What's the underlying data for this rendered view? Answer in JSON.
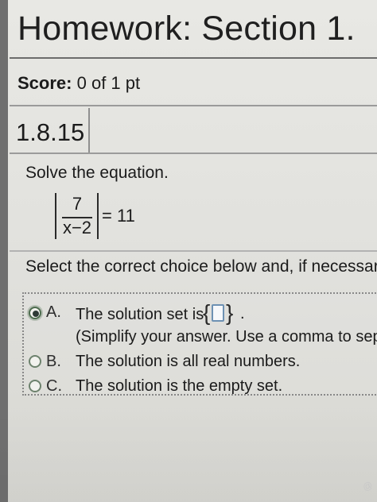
{
  "header": {
    "title": "Homework: Section 1."
  },
  "score": {
    "label": "Score:",
    "value": "0 of 1 pt"
  },
  "question": {
    "number": "1.8.15",
    "prompt": "Solve the equation.",
    "equation": {
      "numerator": "7",
      "denominator": "x−2",
      "rhs": "= 11"
    },
    "instruction": "Select the correct choice below and, if necessary, fil",
    "choices": {
      "a": {
        "letter": "A.",
        "text": "The solution set is",
        "hint": "(Simplify your answer. Use a comma to sepa",
        "period": ".",
        "input_value": ""
      },
      "b": {
        "letter": "B.",
        "text": "The solution is all real numbers."
      },
      "c": {
        "letter": "C.",
        "text": "The solution is the empty set."
      }
    }
  },
  "icons": {
    "selected_radio": "radio-selected-icon",
    "radio": "radio-icon",
    "left_brace": "left-brace-icon",
    "right_brace": "right-brace-icon"
  },
  "colors": {
    "page_background": "#e2e2de",
    "text": "#1b1b1b",
    "input_border": "#6d91b3",
    "radio_border": "#5b6d5c"
  },
  "watermark": "@"
}
